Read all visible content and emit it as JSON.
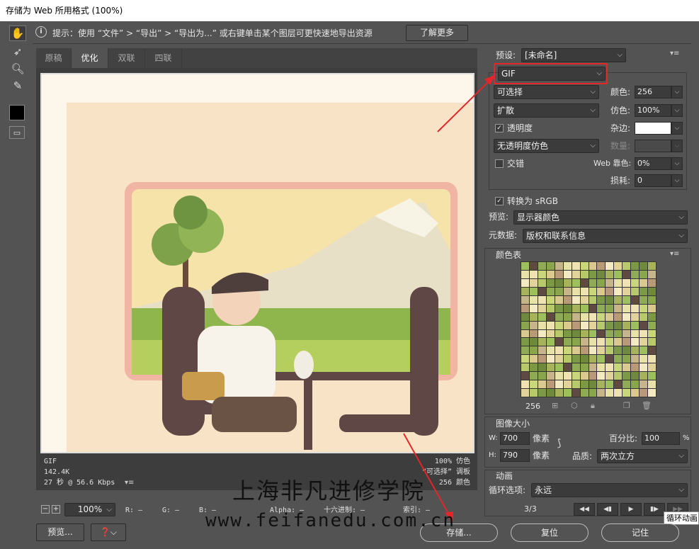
{
  "window": {
    "title": "存储为 Web 所用格式 (100%)"
  },
  "hint": {
    "text": "提示：使用 “文件” > “导出” > “导出为...” 或右键单击某个图层可更快速地导出资源",
    "learn_more": "了解更多"
  },
  "tabs": [
    {
      "label": "原稿"
    },
    {
      "label": "优化"
    },
    {
      "label": "双联"
    },
    {
      "label": "四联"
    }
  ],
  "image_info": {
    "format": "GIF",
    "size": "142.4K",
    "time": "27 秒 @ 56.6 Kbps",
    "dither": "100% 仿色",
    "palette": "“可选择” 调板",
    "colors": "256 颜色"
  },
  "statusbar": {
    "zoom": "100%",
    "r": "R: —",
    "g": "G: —",
    "b": "B: —",
    "alpha": "Alpha: —",
    "hex": "十六进制: —",
    "index": "索引: —"
  },
  "settings": {
    "preset_label": "预设:",
    "preset_value": "[未命名]",
    "format": "GIF",
    "reduction": "可选择",
    "dither_algo": "扩散",
    "transparency_label": "透明度",
    "transparency_dither": "无透明度仿色",
    "interlaced_label": "交错",
    "colors_label": "颜色:",
    "colors_value": "256",
    "dither_label": "仿色:",
    "dither_value": "100%",
    "matte_label": "杂边:",
    "amount_label": "数量:",
    "web_snap_label": "Web 靠色:",
    "web_snap_value": "0%",
    "lossy_label": "损耗:",
    "lossy_value": "0",
    "convert_srgb_label": "转换为 sRGB",
    "preview_label": "预览:",
    "preview_value": "显示器颜色",
    "metadata_label": "元数据:",
    "metadata_value": "版权和联系信息"
  },
  "color_table": {
    "title": "颜色表",
    "count": "256",
    "colors": [
      "#9dbf5e",
      "#c9d67a",
      "#6f8a3c",
      "#e8e1a8",
      "#b7c96b",
      "#8aa64c",
      "#f3e9c2",
      "#5e4a43",
      "#d9c98f",
      "#a7b35a",
      "#efe3b3",
      "#7c9a46",
      "#c6b58a",
      "#e2d39a",
      "#90ab55",
      "#b89a78"
    ]
  },
  "image_size": {
    "title": "图像大小",
    "w_label": "W:",
    "w_value": "700",
    "h_label": "H:",
    "h_value": "790",
    "unit": "像素",
    "percent_label": "百分比:",
    "percent_value": "100",
    "percent_unit": "%",
    "quality_label": "品质:",
    "quality_value": "两次立方"
  },
  "animation": {
    "title": "动画",
    "loop_label": "循环选项:",
    "loop_value": "永远",
    "frame": "3/3",
    "tooltip": "循环动画"
  },
  "footer": {
    "preview": "预览...",
    "save": "存储...",
    "reset": "复位",
    "remember": "记住"
  },
  "watermark": {
    "line1": "上海非凡进修学院",
    "line2": "www.feifanedu.com.cn"
  }
}
